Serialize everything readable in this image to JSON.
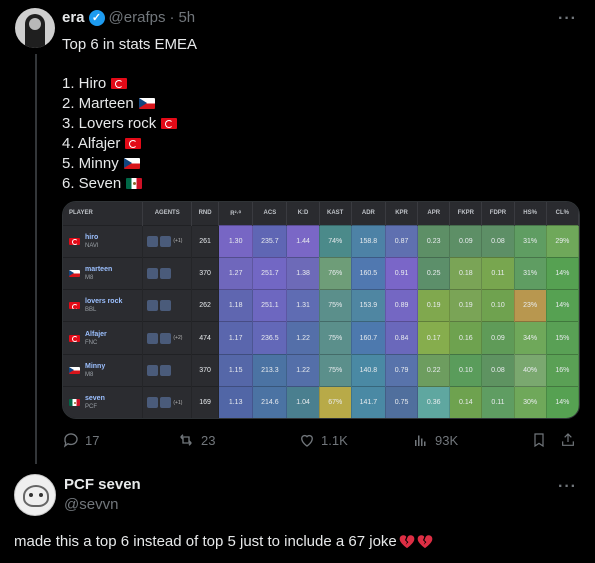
{
  "tweet": {
    "author_name": "era",
    "handle": "@erafps",
    "separator": "·",
    "time": "5h",
    "more": "···",
    "text": "Top 6 in stats EMEA",
    "ranking": [
      {
        "text": "1. Hiro",
        "flag": "tr"
      },
      {
        "text": "2. Marteen",
        "flag": "cz"
      },
      {
        "text": "3. Lovers rock",
        "flag": "tr"
      },
      {
        "text": "4. Alfajer",
        "flag": "tr"
      },
      {
        "text": "5. Minny",
        "flag": "cz"
      },
      {
        "text": "6. Seven",
        "flag": "mx"
      }
    ],
    "actions": {
      "replies": "17",
      "reposts": "23",
      "likes": "1.1K",
      "views": "93K"
    }
  },
  "stats_table": {
    "headers": [
      "PLAYER",
      "AGENTS",
      "RND",
      "R²·⁰",
      "ACS",
      "K:D",
      "KAST",
      "ADR",
      "KPR",
      "APR",
      "FKPR",
      "FDPR",
      "HS%",
      "CL%"
    ],
    "rows": [
      {
        "player": "hiro",
        "team": "NAVI",
        "flag": "tr",
        "agents_extra": "(+1)",
        "values": [
          "261",
          "1.30",
          "235.7",
          "1.44",
          "74%",
          "158.8",
          "0.87",
          "0.23",
          "0.09",
          "0.08",
          "31%",
          "29%"
        ]
      },
      {
        "player": "marteen",
        "team": "M8",
        "flag": "cz",
        "agents_extra": "",
        "values": [
          "370",
          "1.27",
          "251.7",
          "1.38",
          "76%",
          "160.5",
          "0.91",
          "0.25",
          "0.18",
          "0.11",
          "31%",
          "14%"
        ]
      },
      {
        "player": "lovers rock",
        "team": "BBL",
        "flag": "tr",
        "agents_extra": "",
        "values": [
          "262",
          "1.18",
          "251.1",
          "1.31",
          "75%",
          "153.9",
          "0.89",
          "0.19",
          "0.19",
          "0.10",
          "23%",
          "14%"
        ]
      },
      {
        "player": "Alfajer",
        "team": "FNC",
        "flag": "tr",
        "agents_extra": "(+2)",
        "values": [
          "474",
          "1.17",
          "236.5",
          "1.22",
          "75%",
          "160.7",
          "0.84",
          "0.17",
          "0.16",
          "0.09",
          "34%",
          "15%"
        ]
      },
      {
        "player": "Minny",
        "team": "M8",
        "flag": "cz",
        "agents_extra": "",
        "values": [
          "370",
          "1.15",
          "213.3",
          "1.22",
          "75%",
          "140.8",
          "0.79",
          "0.22",
          "0.10",
          "0.08",
          "40%",
          "16%"
        ]
      },
      {
        "player": "seven",
        "team": "PCF",
        "flag": "mx",
        "agents_extra": "(+1)",
        "values": [
          "169",
          "1.13",
          "214.6",
          "1.04",
          "67%",
          "141.7",
          "0.75",
          "0.36",
          "0.14",
          "0.11",
          "30%",
          "14%"
        ]
      }
    ],
    "cell_colors": [
      [
        "#7766c4",
        "#5f66b4",
        "#7a67c6",
        "#4b8a8a",
        "#4d82a6",
        "#5f70b0",
        "#5d8f66",
        "#5d8f66",
        "#5d8f66",
        "#5f9d62",
        "#6fa85a"
      ],
      [
        "#6f67bc",
        "#7267c4",
        "#6d6ab8",
        "#6e9d78",
        "#5078b0",
        "#7a66c8",
        "#5c8f6a",
        "#7aa456",
        "#78a64f",
        "#5f9d62",
        "#56a152"
      ],
      [
        "#5f66b0",
        "#6d67c0",
        "#5f6cb3",
        "#5b8f8b",
        "#4f86a2",
        "#7467c3",
        "#80a84e",
        "#7aa456",
        "#6fa24f",
        "#b8974f",
        "#56a152"
      ],
      [
        "#5a66ad",
        "#6368b8",
        "#546fa9",
        "#5b8f8b",
        "#4d79ae",
        "#6a68bb",
        "#86ad4d",
        "#6ea24f",
        "#5f9b58",
        "#6fa85a",
        "#59a055"
      ],
      [
        "#5567a8",
        "#4b73a3",
        "#546fa9",
        "#5b8f8b",
        "#4a89a4",
        "#5873ab",
        "#6d9d5f",
        "#5a9c5b",
        "#5e9361",
        "#7aa86f",
        "#5aa055"
      ],
      [
        "#5166a6",
        "#4b73a3",
        "#4a7f8f",
        "#b8aa48",
        "#4a89a4",
        "#506f9d",
        "#5fa7a0",
        "#6ea24f",
        "#5f9d62",
        "#6fa85a",
        "#56a152"
      ]
    ]
  },
  "reply": {
    "author_name": "PCF seven",
    "handle": "@sevvn",
    "more": "···",
    "text": "made this a top 6 instead of top 5 just to include a 67 joke"
  }
}
